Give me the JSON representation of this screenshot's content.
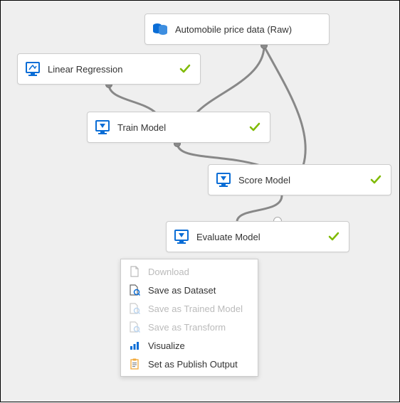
{
  "nodes": {
    "data": {
      "label": "Automobile price data (Raw)"
    },
    "linreg": {
      "label": "Linear Regression"
    },
    "train": {
      "label": "Train Model"
    },
    "score": {
      "label": "Score Model"
    },
    "eval": {
      "label": "Evaluate Model"
    }
  },
  "menu": {
    "download": "Download",
    "save_dataset": "Save as Dataset",
    "save_trained": "Save as Trained Model",
    "save_transform": "Save as Transform",
    "visualize": "Visualize",
    "publish": "Set as Publish Output"
  },
  "colors": {
    "primary": "#0a6dd6",
    "check": "#7fba00",
    "orange": "#f2a93b"
  }
}
